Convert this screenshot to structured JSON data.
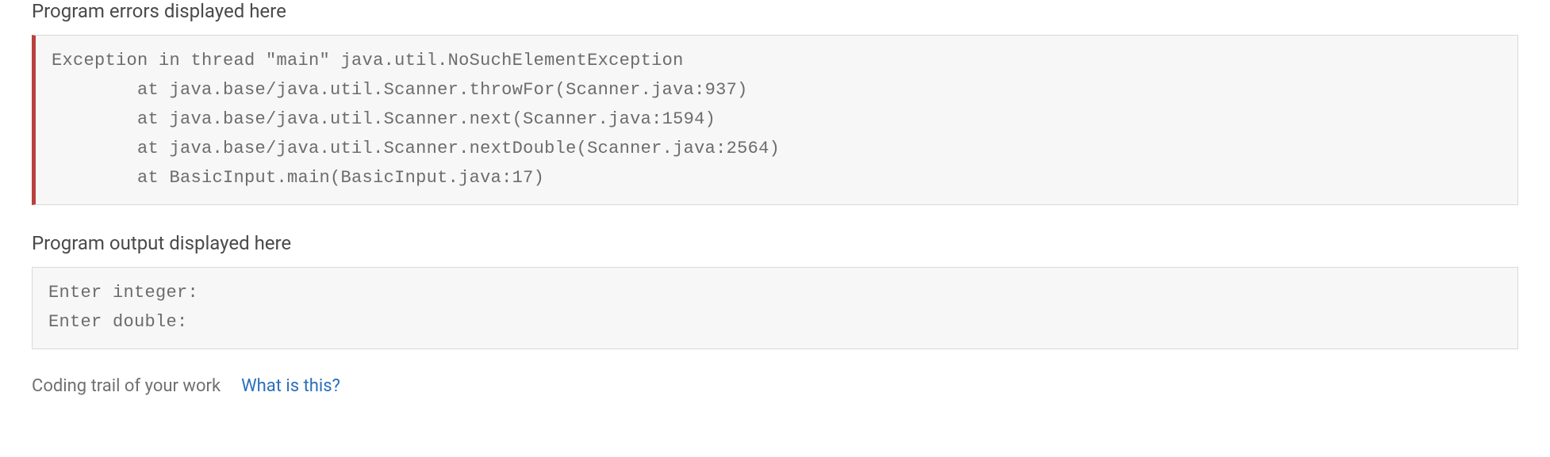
{
  "errors": {
    "heading": "Program errors displayed here",
    "text": "Exception in thread \"main\" java.util.NoSuchElementException\n        at java.base/java.util.Scanner.throwFor(Scanner.java:937)\n        at java.base/java.util.Scanner.next(Scanner.java:1594)\n        at java.base/java.util.Scanner.nextDouble(Scanner.java:2564)\n        at BasicInput.main(BasicInput.java:17)"
  },
  "output": {
    "heading": "Program output displayed here",
    "text": "Enter integer:\nEnter double:"
  },
  "footer": {
    "label": "Coding trail of your work",
    "link": "What is this?"
  }
}
